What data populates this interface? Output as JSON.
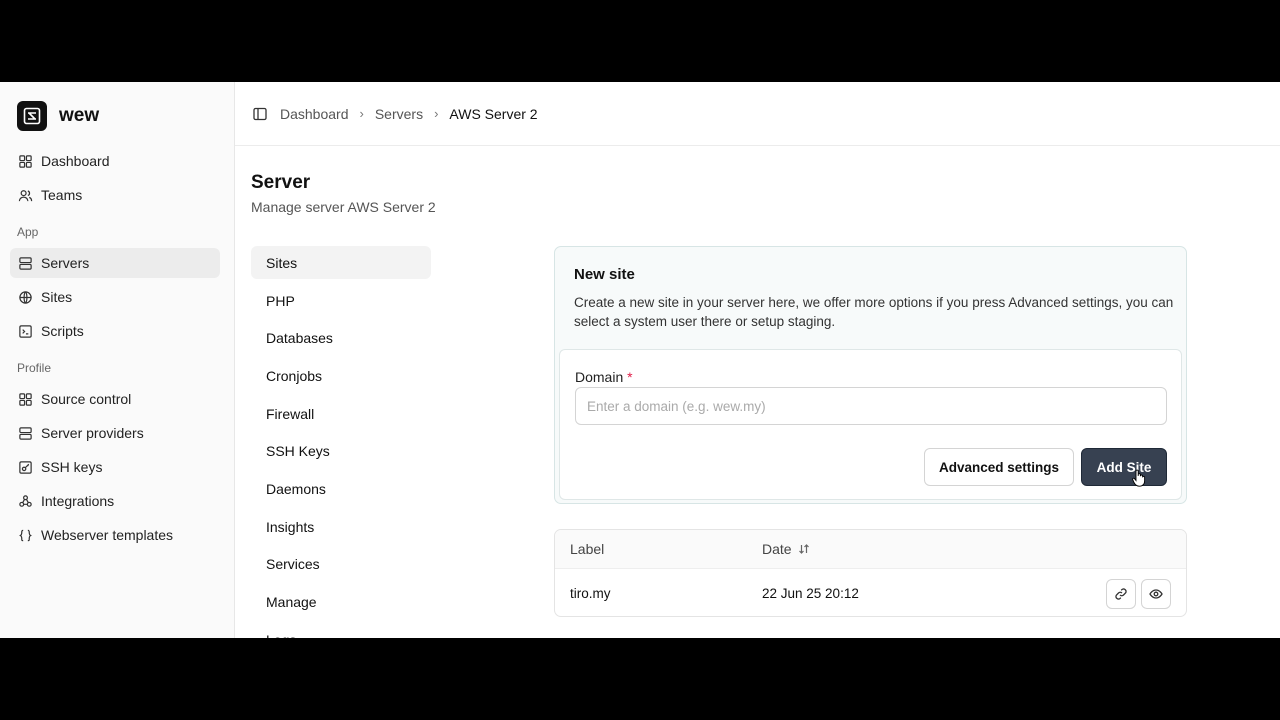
{
  "brand": {
    "name": "wew"
  },
  "sidebar": {
    "items": [
      {
        "label": "Dashboard",
        "icon": "grid-icon"
      },
      {
        "label": "Teams",
        "icon": "users-icon"
      }
    ],
    "app_group_label": "App",
    "app_items": [
      {
        "label": "Servers",
        "icon": "server-icon",
        "active": true
      },
      {
        "label": "Sites",
        "icon": "globe-icon"
      },
      {
        "label": "Scripts",
        "icon": "terminal-icon"
      }
    ],
    "profile_group_label": "Profile",
    "profile_items": [
      {
        "label": "Source control",
        "icon": "grid-icon"
      },
      {
        "label": "Server providers",
        "icon": "server-icon"
      },
      {
        "label": "SSH keys",
        "icon": "key-icon"
      },
      {
        "label": "Integrations",
        "icon": "integrations-icon"
      },
      {
        "label": "Webserver templates",
        "icon": "braces-icon"
      }
    ]
  },
  "breadcrumb": [
    "Dashboard",
    "Servers",
    "AWS Server 2"
  ],
  "page": {
    "title": "Server",
    "subtitle": "Manage server AWS Server 2"
  },
  "subnav": [
    "Sites",
    "PHP",
    "Databases",
    "Cronjobs",
    "Firewall",
    "SSH Keys",
    "Daemons",
    "Insights",
    "Services",
    "Manage",
    "Logs"
  ],
  "new_site": {
    "title": "New site",
    "description": "Create a new site in your server here, we offer more options if you press Advanced settings, you can select a system user there or setup staging.",
    "domain_label": "Domain",
    "required_mark": "*",
    "domain_placeholder": "Enter a domain (e.g. wew.my)",
    "domain_value": "",
    "advanced_label": "Advanced settings",
    "add_label": "Add Site"
  },
  "table": {
    "columns": [
      "Label",
      "Date"
    ],
    "rows": [
      {
        "label": "tiro.my",
        "date": "22 Jun 25 20:12"
      }
    ]
  },
  "colors": {
    "primary_button": "#374151",
    "required": "#e11d48",
    "active_nav": "#ececec"
  }
}
